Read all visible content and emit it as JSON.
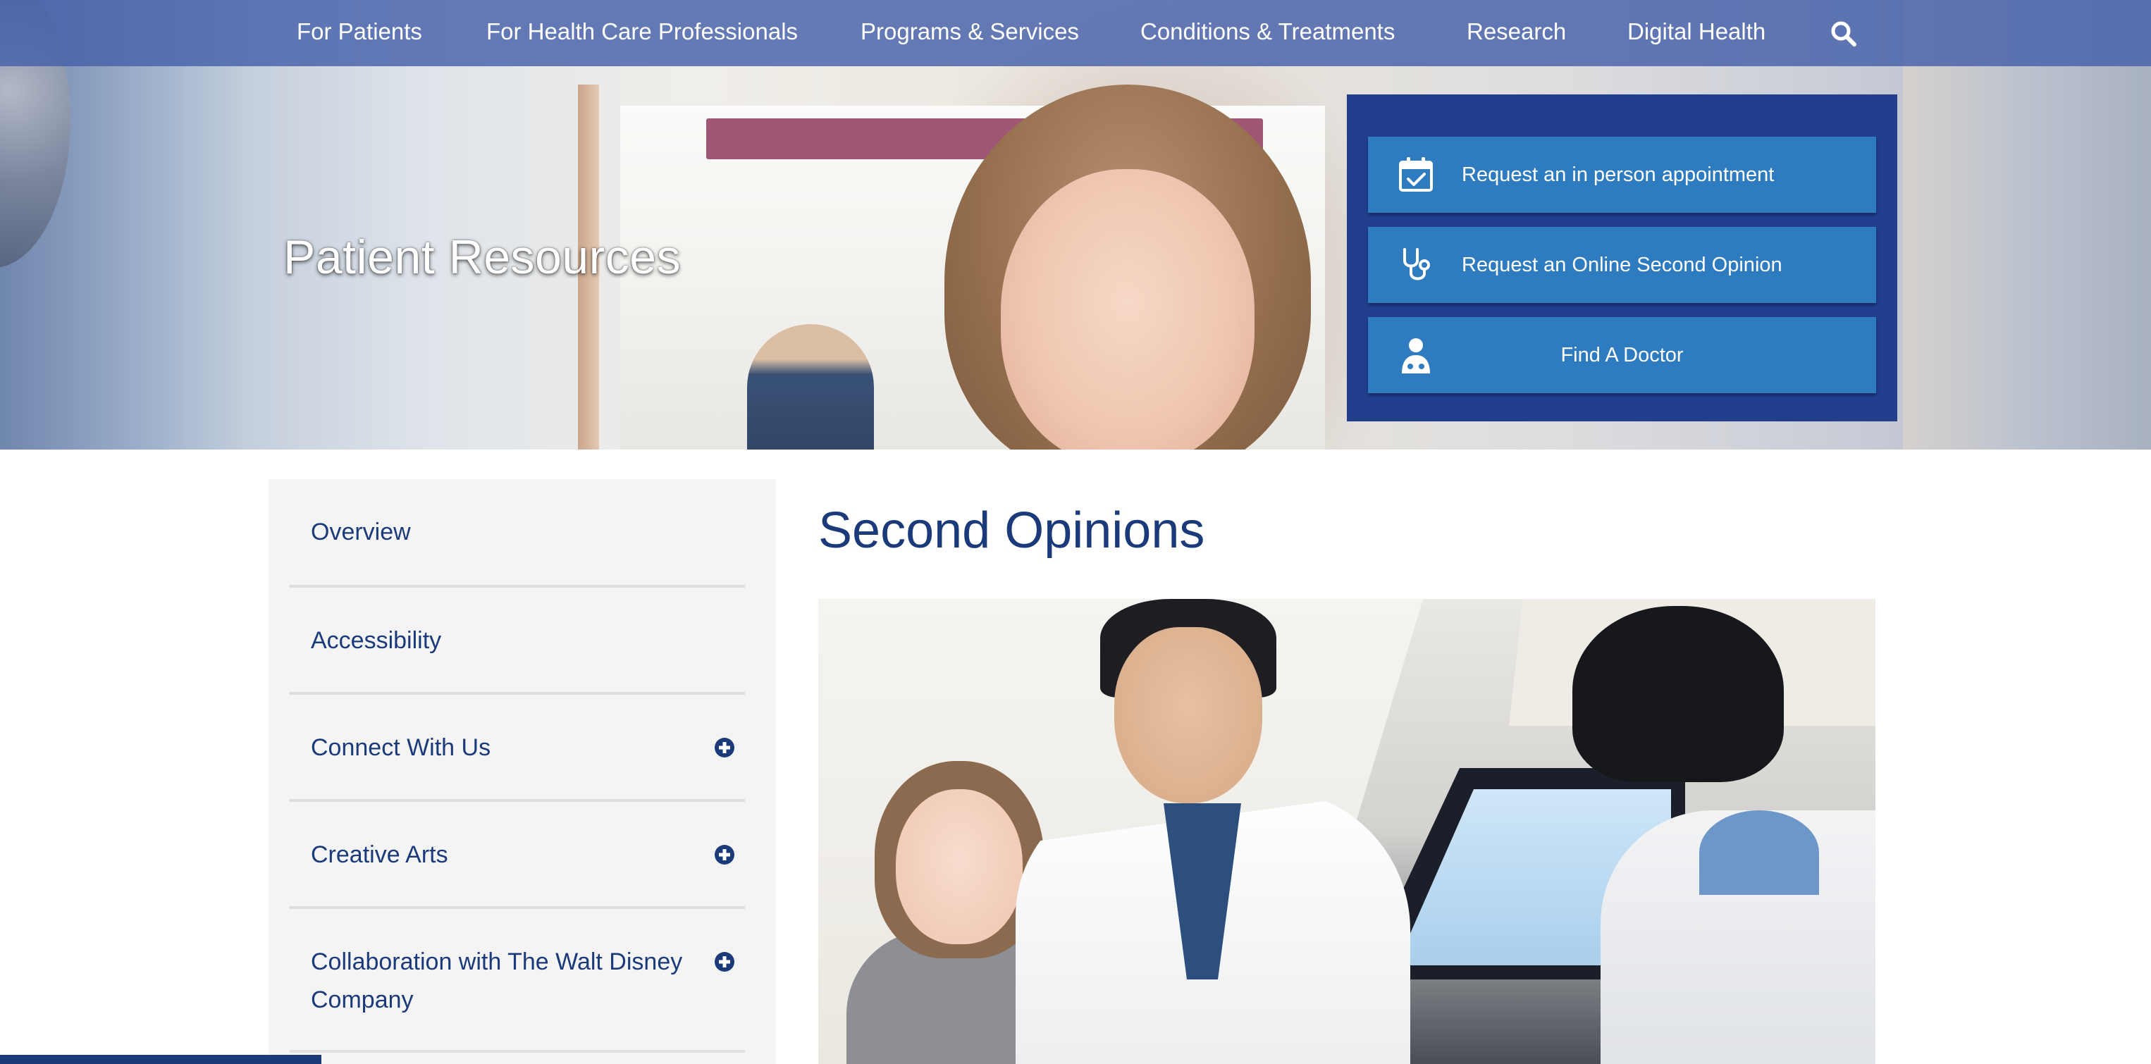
{
  "header": {
    "nav": [
      {
        "label": "For Patients"
      },
      {
        "label": "For Health Care Professionals"
      },
      {
        "label": "Programs & Services"
      },
      {
        "label": "Conditions & Treatments"
      },
      {
        "label": "Research"
      },
      {
        "label": "Digital Health"
      }
    ],
    "search_icon": "search-icon"
  },
  "hero": {
    "title": "Patient Resources",
    "actions": [
      {
        "label": "Request an in person appointment",
        "icon": "calendar-check-icon"
      },
      {
        "label": "Request an Online Second Opinion",
        "icon": "stethoscope-icon"
      },
      {
        "label": "Find A Doctor",
        "icon": "doctor-icon"
      }
    ]
  },
  "sidebar": {
    "items": [
      {
        "label": "Overview"
      },
      {
        "label": "Accessibility"
      },
      {
        "label": "Connect With Us",
        "expand_icon": "plus-circle-icon"
      },
      {
        "label": "Creative Arts",
        "expand_icon": "plus-circle-icon"
      },
      {
        "label": "Collaboration with The Walt Disney Company",
        "expand_icon": "plus-circle-icon"
      }
    ]
  },
  "main": {
    "title": "Second Opinions"
  },
  "colors": {
    "nav_bg": "#4660aa",
    "panel_bg": "#223f8e",
    "button_bg": "#2f7bbf",
    "heading": "#1b3a7a",
    "sidebar_bg": "#f4f4f4"
  }
}
